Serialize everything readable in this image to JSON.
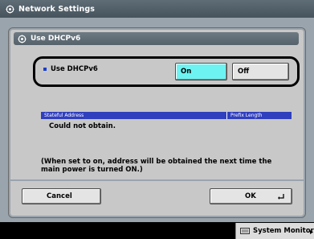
{
  "window": {
    "title": "Network Settings"
  },
  "panel": {
    "title": "Use DHCPv6"
  },
  "setting": {
    "label": "Use DHCPv6",
    "options": [
      {
        "label": "On",
        "selected": true
      },
      {
        "label": "Off",
        "selected": false
      }
    ]
  },
  "address_table": {
    "columns": [
      "Stateful Address",
      "Prefix Length"
    ],
    "value": "Could not obtain."
  },
  "note": "(When set to on, address will be obtained the next time the main power is turned ON.)",
  "actions": {
    "cancel_label": "Cancel",
    "ok_label": "OK"
  },
  "status": {
    "system_monitor_label": "System Monitor"
  },
  "colors": {
    "selected_option": "#6df3f2",
    "table_header": "#2f3fbd",
    "title_bar": "#4f5c65"
  }
}
